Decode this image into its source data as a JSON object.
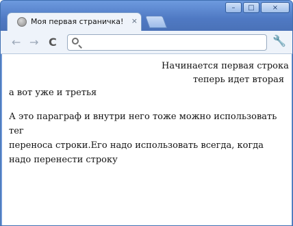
{
  "tab": {
    "title": "Моя первая страничка!",
    "close": "×"
  },
  "window_controls": {
    "minimize": "–",
    "maximize": "□",
    "close": "×"
  },
  "toolbar": {
    "back": "←",
    "forward": "→",
    "reload": "C",
    "address_value": "",
    "wrench": "🔧"
  },
  "content": {
    "line1": "Начинается первая строка",
    "line2": "теперь идет вторая",
    "line3": "а вот уже и третья",
    "para1": "А это параграф и внутри него тоже можно использовать",
    "para2": "тег",
    "para3": "переноса строки.Его надо использовать всегда, когда",
    "para4": "надо перенести строку"
  }
}
